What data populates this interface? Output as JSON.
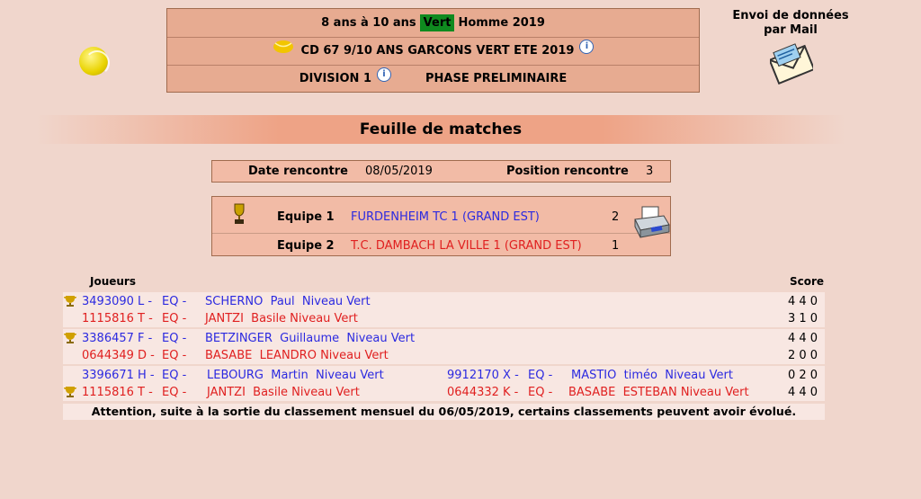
{
  "header": {
    "row1_a": "8 ans  à 10 ans",
    "row1_badge": "Vert",
    "row1_b": "Homme  2019",
    "row2": "CD 67 9/10 ANS GARCONS VERT ETE 2019",
    "row3_division": "DIVISION 1",
    "row3_phase": "PHASE PRELIMINAIRE"
  },
  "mail": {
    "line1": "Envoi de données",
    "line2": "par Mail"
  },
  "banner_title": "Feuille de matches",
  "meeting": {
    "date_label": "Date rencontre",
    "date_value": "08/05/2019",
    "position_label": "Position rencontre",
    "position_value": "3"
  },
  "teams": {
    "team1_label": "Equipe 1",
    "team1_name": "FURDENHEIM TC 1 (GRAND EST)",
    "team1_score": "2",
    "team2_label": "Equipe 2",
    "team2_name": "T.C. DAMBACH LA VILLE 1 (GRAND EST)",
    "team2_score": "1"
  },
  "columns": {
    "players": "Joueurs",
    "score": "Score"
  },
  "matches": [
    {
      "p1": {
        "id": "3493090 L -",
        "eq": "EQ -",
        "name": "SCHERNO  Paul  Niveau Vert",
        "score": "4 4 0"
      },
      "p2": {
        "id": "1115816 T -",
        "eq": "EQ -",
        "name": "JANTZI  Basile Niveau Vert",
        "score": "3 1 0"
      }
    },
    {
      "p1": {
        "id": "3386457 F -",
        "eq": "EQ -",
        "name": "BETZINGER  Guillaume  Niveau Vert",
        "score": "4 4 0"
      },
      "p2": {
        "id": "0644349 D -",
        "eq": "EQ -",
        "name": "BASABE  LEANDRO Niveau Vert",
        "score": "2 0 0"
      }
    },
    {
      "p1": {
        "id": "3396671 H -",
        "eq": "EQ -",
        "name": "LEBOURG  Martin  Niveau Vert",
        "id_b": "9912170 X -",
        "eq_b": "EQ -",
        "name_b": "MASTIO  timéo  Niveau Vert",
        "score": "0 2 0"
      },
      "p2": {
        "id": "1115816 T -",
        "eq": "EQ -",
        "name": "JANTZI  Basile Niveau Vert",
        "id_b": "0644332 K -",
        "eq_b": "EQ -",
        "name_b": "BASABE  ESTEBAN Niveau Vert",
        "score": "4 4 0"
      }
    }
  ],
  "attention": "Attention, suite à la sortie du classement mensuel du 06/05/2019, certains classements peuvent avoir évolué.",
  "colors": {
    "blue": "#2c2ae0",
    "red": "#e02020",
    "badge": "#0f8a1f"
  }
}
